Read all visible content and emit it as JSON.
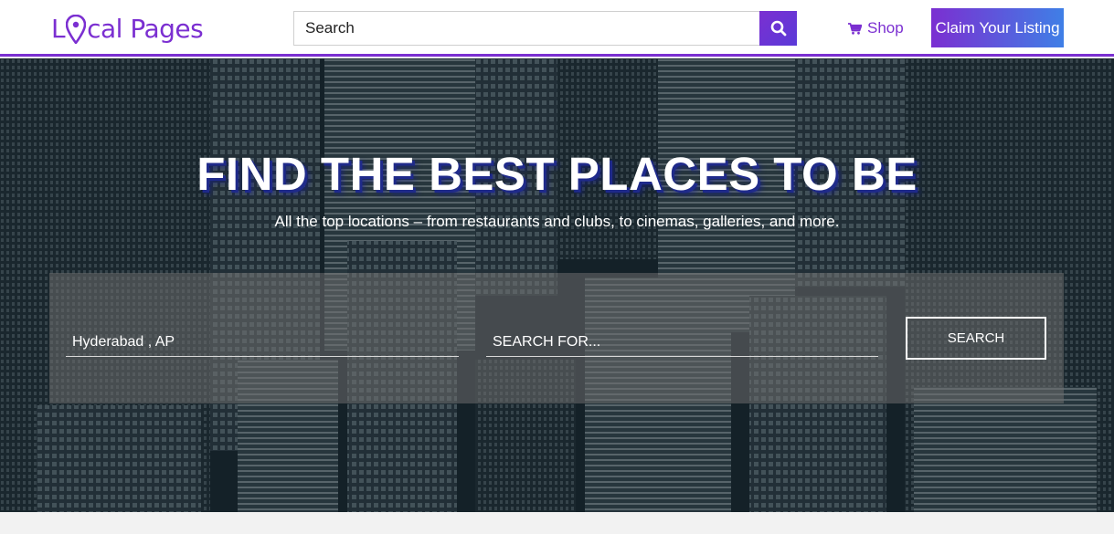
{
  "header": {
    "logo": {
      "part1": "L",
      "part2": "cal Pages",
      "icon": "map-pin-icon"
    },
    "search": {
      "placeholder": "Search",
      "button_icon": "search-icon"
    },
    "shop": {
      "label": "Shop",
      "icon": "shopping-cart-icon"
    },
    "claim_button": "Claim Your Listing"
  },
  "hero": {
    "title": "FIND THE BEST PLACES TO BE",
    "subtitle": "All the top locations – from restaurants and clubs, to cinemas, galleries, and more.",
    "search_panel": {
      "location_value": "Hyderabad , AP",
      "query_placeholder": "SEARCH FOR...",
      "button_label": "SEARCH"
    }
  },
  "colors": {
    "brand_purple": "#7b2fd1",
    "brand_blue": "#3f7fe6",
    "header_bg": "#ffffff",
    "hero_overlay": "#1c2a31"
  }
}
